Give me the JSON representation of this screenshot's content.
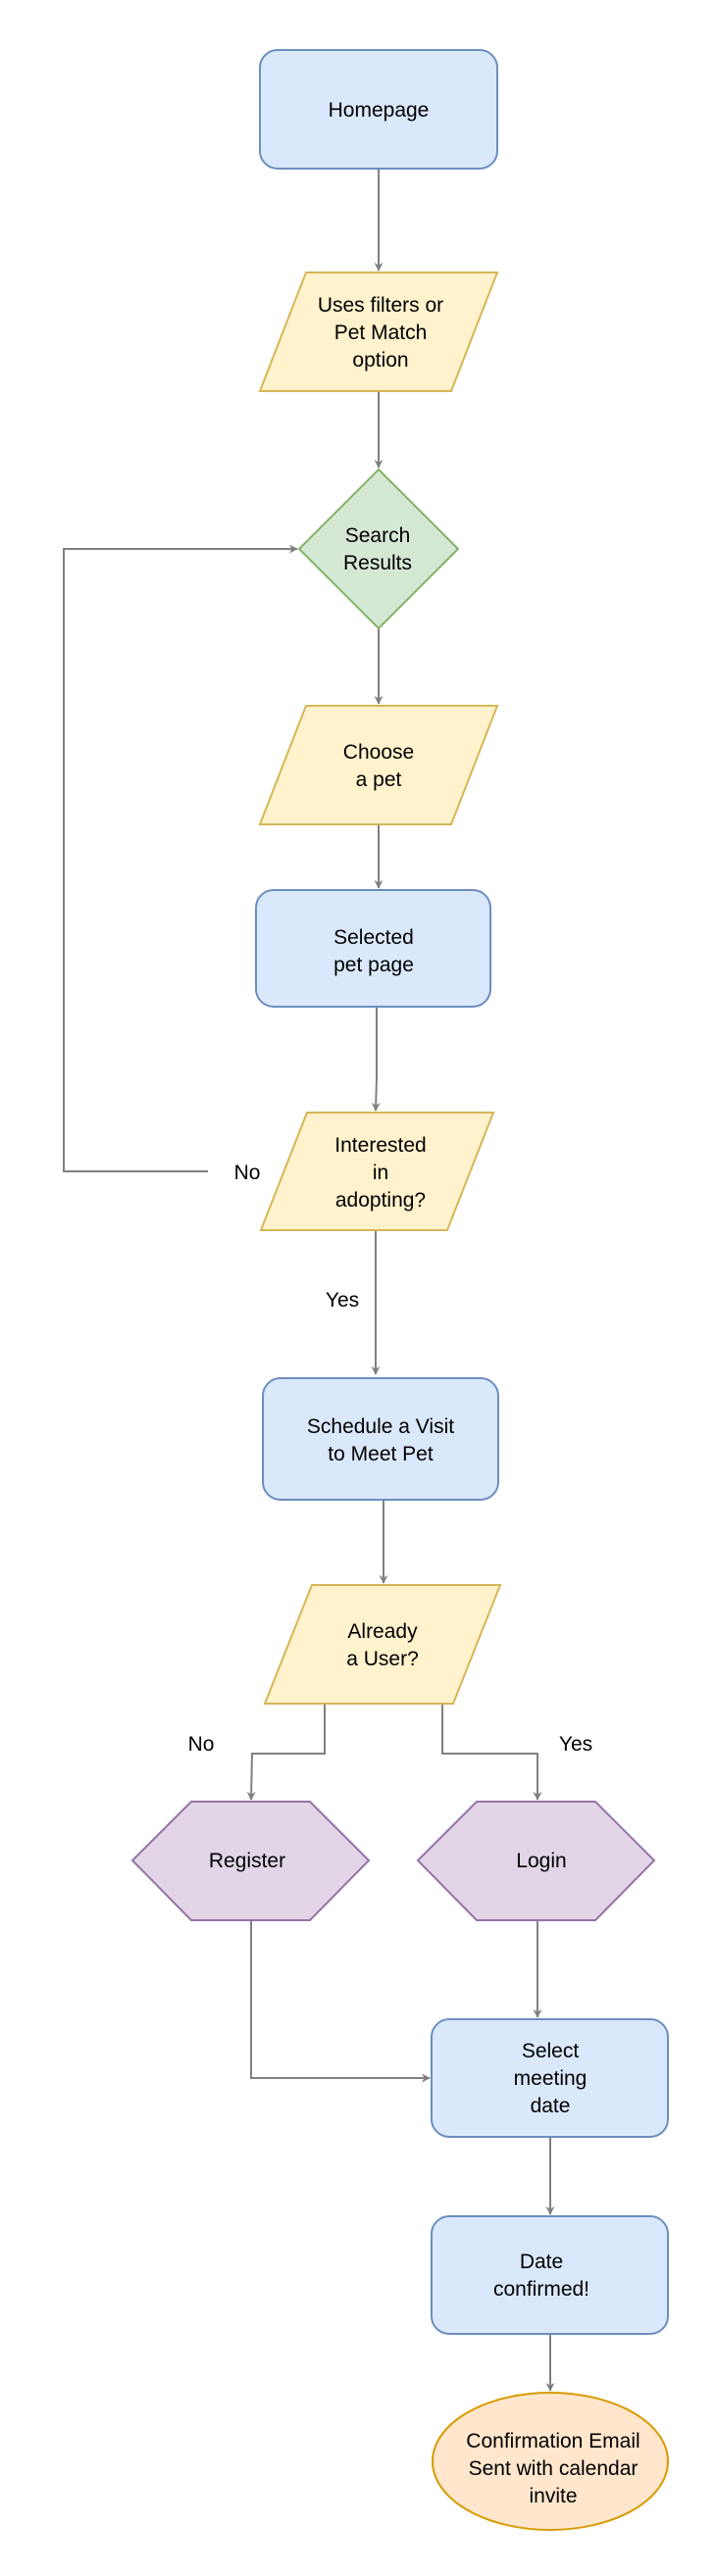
{
  "colors": {
    "process_fill": "#dae8fc",
    "process_stroke": "#6c8ebf",
    "io_fill": "#fff2cc",
    "io_stroke": "#d6b656",
    "decision_fill": "#d5e8d4",
    "decision_stroke": "#82b366",
    "prep_fill": "#e1d5e7",
    "prep_stroke": "#9673a6",
    "terminal_fill": "#ffe6cc",
    "terminal_stroke": "#d79b00",
    "edge": "#808080"
  },
  "nodes": {
    "homepage": {
      "lines": [
        "Homepage"
      ]
    },
    "filters": {
      "lines": [
        "Uses filters or",
        "Pet Match",
        "option"
      ]
    },
    "search": {
      "lines": [
        "Search",
        "Results"
      ]
    },
    "choose": {
      "lines": [
        "Choose",
        "a pet"
      ]
    },
    "selected": {
      "lines": [
        "Selected",
        "pet page"
      ]
    },
    "interested": {
      "lines": [
        "Interested",
        "in",
        "adopting?"
      ]
    },
    "schedule": {
      "lines": [
        "Schedule a Visit",
        "to Meet Pet"
      ]
    },
    "already": {
      "lines": [
        "Already",
        "a User?"
      ]
    },
    "register": {
      "lines": [
        "Register"
      ]
    },
    "login": {
      "lines": [
        "Login"
      ]
    },
    "select_date": {
      "lines": [
        "Select",
        "meeting",
        "date"
      ]
    },
    "confirmed": {
      "lines": [
        "Date",
        "confirmed!"
      ]
    },
    "email": {
      "lines": [
        "Confirmation Email",
        "Sent with calendar",
        "invite"
      ]
    }
  },
  "edge_labels": {
    "interested_no": "No",
    "interested_yes": "Yes",
    "user_no": "No",
    "user_yes": "Yes"
  }
}
